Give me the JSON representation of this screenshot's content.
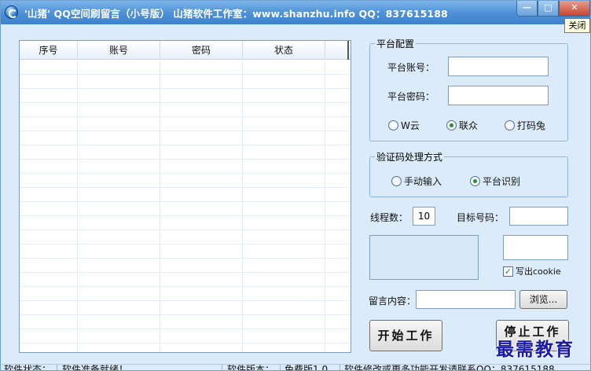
{
  "window": {
    "title": "'山猪' QQ空间刷留言（小号版） 山猪软件工作室：www.shanzhu.info QQ：837615188",
    "min_label": "—",
    "max_label": "□",
    "close_label": "✕",
    "close_tooltip": "关闭"
  },
  "account_list": {
    "columns": [
      "序号",
      "账号",
      "密码",
      "状态"
    ],
    "rows": []
  },
  "platform_config": {
    "legend": "平台配置",
    "account_label": "平台账号：",
    "account_value": "",
    "password_label": "平台密码：",
    "password_value": "",
    "options": [
      "W云",
      "联众",
      "打码兔"
    ],
    "selected": "联众"
  },
  "captcha_method": {
    "legend": "验证码处理方式",
    "options": [
      "手动输入",
      "平台识别"
    ],
    "selected": "平台识别"
  },
  "threads": {
    "label": "线程数：",
    "value": "10"
  },
  "target_qq": {
    "label": "目标号码：",
    "value": ""
  },
  "cookie": {
    "label": "写出cookie",
    "checked": true
  },
  "message": {
    "label": "留言内容：",
    "value": "",
    "browse_label": "浏览..."
  },
  "buttons": {
    "start": "开始工作",
    "stop": "停止工作"
  },
  "statusbar": {
    "state_label": "软件状态：",
    "state_value": "软件准备就绪！",
    "version_label": "软件版本：",
    "version_value": "免费版1.0",
    "contact_text": "软件修改或更多功能开发请联系QQ：837615188"
  },
  "watermark": "最需教育"
}
